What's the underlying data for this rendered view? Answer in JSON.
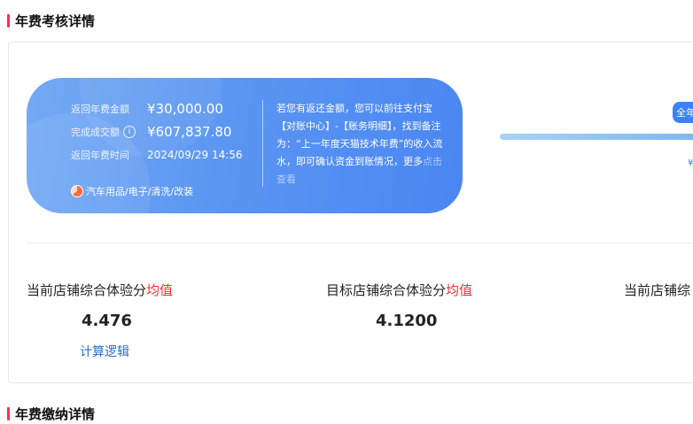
{
  "sections": {
    "annual_fee_assessment_title": "年费考核详情",
    "annual_fee_payment_title": "年费缴纳详情"
  },
  "refund_panel": {
    "refund_amount_label": "返回年费金额",
    "refund_amount_value": "¥30,000.00",
    "completed_sales_label": "完成成交额",
    "completed_sales_value": "¥607,837.80",
    "refund_time_label": "返回年费时间",
    "refund_time_value": "2024/09/29 14:56",
    "category": "汽车用品/电子/清洗/改装",
    "note": "若您有返还金额，您可以前往支付宝【对账中心】-【账务明细】，找到备注为：“上一年度天猫技术年费”的收入流水，即可确认资金到账情况，更多",
    "note_link": "点击查看"
  },
  "progress": {
    "tier_badge": "全年",
    "tier_caption": "¥"
  },
  "metrics": [
    {
      "label": "当前店铺综合体验分",
      "accent": "均值",
      "value": "4.476"
    },
    {
      "label": "目标店铺综合体验分",
      "accent": "均值",
      "value": "4.1200"
    },
    {
      "label": "当前店铺综",
      "accent": ""
    }
  ],
  "calc_logic_link": "计算逻辑",
  "colors": {
    "accent_red": "#ff2d55",
    "panel_blue": "#5b96f2",
    "link_blue": "#2b6cc4"
  },
  "icons": {
    "info": "info-circle-icon",
    "category": "category-pie-icon"
  }
}
